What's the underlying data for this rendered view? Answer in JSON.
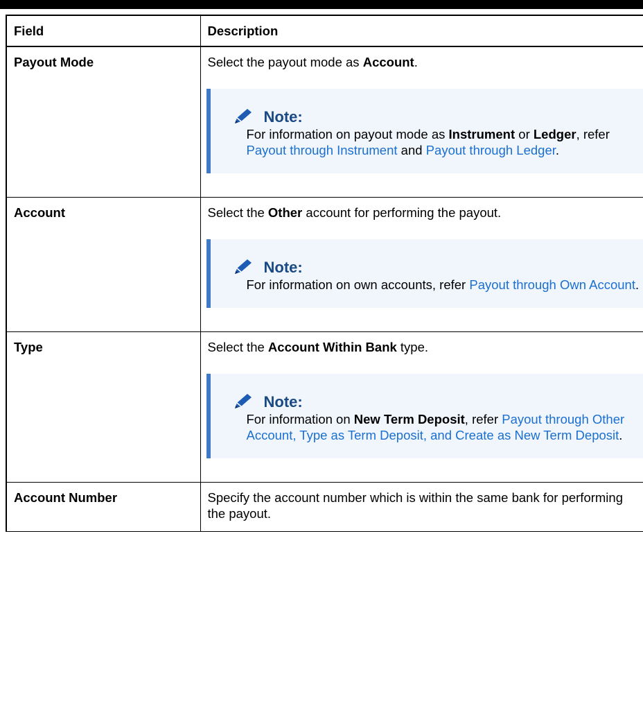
{
  "table": {
    "headers": [
      "Field",
      "Description"
    ],
    "rows": [
      {
        "field": "Payout Mode",
        "desc": {
          "pre": "Select the payout mode as ",
          "bold": "Account",
          "post": "."
        },
        "note": {
          "title": "Note:",
          "parts": [
            {
              "type": "text",
              "text": "For information on payout mode as "
            },
            {
              "type": "bold",
              "text": "Instrument"
            },
            {
              "type": "text",
              "text": " or "
            },
            {
              "type": "bold",
              "text": "Ledger"
            },
            {
              "type": "text",
              "text": ", refer "
            },
            {
              "type": "link",
              "text": "Payout through Instrument"
            },
            {
              "type": "text",
              "text": " and "
            },
            {
              "type": "link",
              "text": "Payout through Ledger"
            },
            {
              "type": "text",
              "text": "."
            }
          ]
        }
      },
      {
        "field": "Account",
        "desc": {
          "pre": "Select the ",
          "bold": "Other",
          "post": " account for performing the payout."
        },
        "note": {
          "title": "Note:",
          "parts": [
            {
              "type": "text",
              "text": "For information on own accounts, refer "
            },
            {
              "type": "link",
              "text": "Payout through Own Account"
            },
            {
              "type": "text",
              "text": "."
            }
          ]
        }
      },
      {
        "field": "Type",
        "desc": {
          "pre": "Select the ",
          "bold": "Account Within Bank",
          "post": " type."
        },
        "note": {
          "title": "Note:",
          "parts": [
            {
              "type": "text",
              "text": "For information on "
            },
            {
              "type": "bold",
              "text": "New Term Deposit"
            },
            {
              "type": "text",
              "text": ", refer "
            },
            {
              "type": "link",
              "text": "Payout through Other Account, Type as Term Deposit, and Create as New Term Deposit"
            },
            {
              "type": "text",
              "text": "."
            }
          ]
        }
      },
      {
        "field": "Account Number",
        "desc": {
          "pre": "Specify the account number which is within the same bank for performing the payout.",
          "bold": "",
          "post": ""
        }
      }
    ]
  },
  "icons": {
    "note": "pencil-icon"
  },
  "colors": {
    "note_bg": "#f1f6fd",
    "note_bar": "#3f79c8",
    "note_title": "#1a4a83",
    "link": "#1a6fd1"
  }
}
